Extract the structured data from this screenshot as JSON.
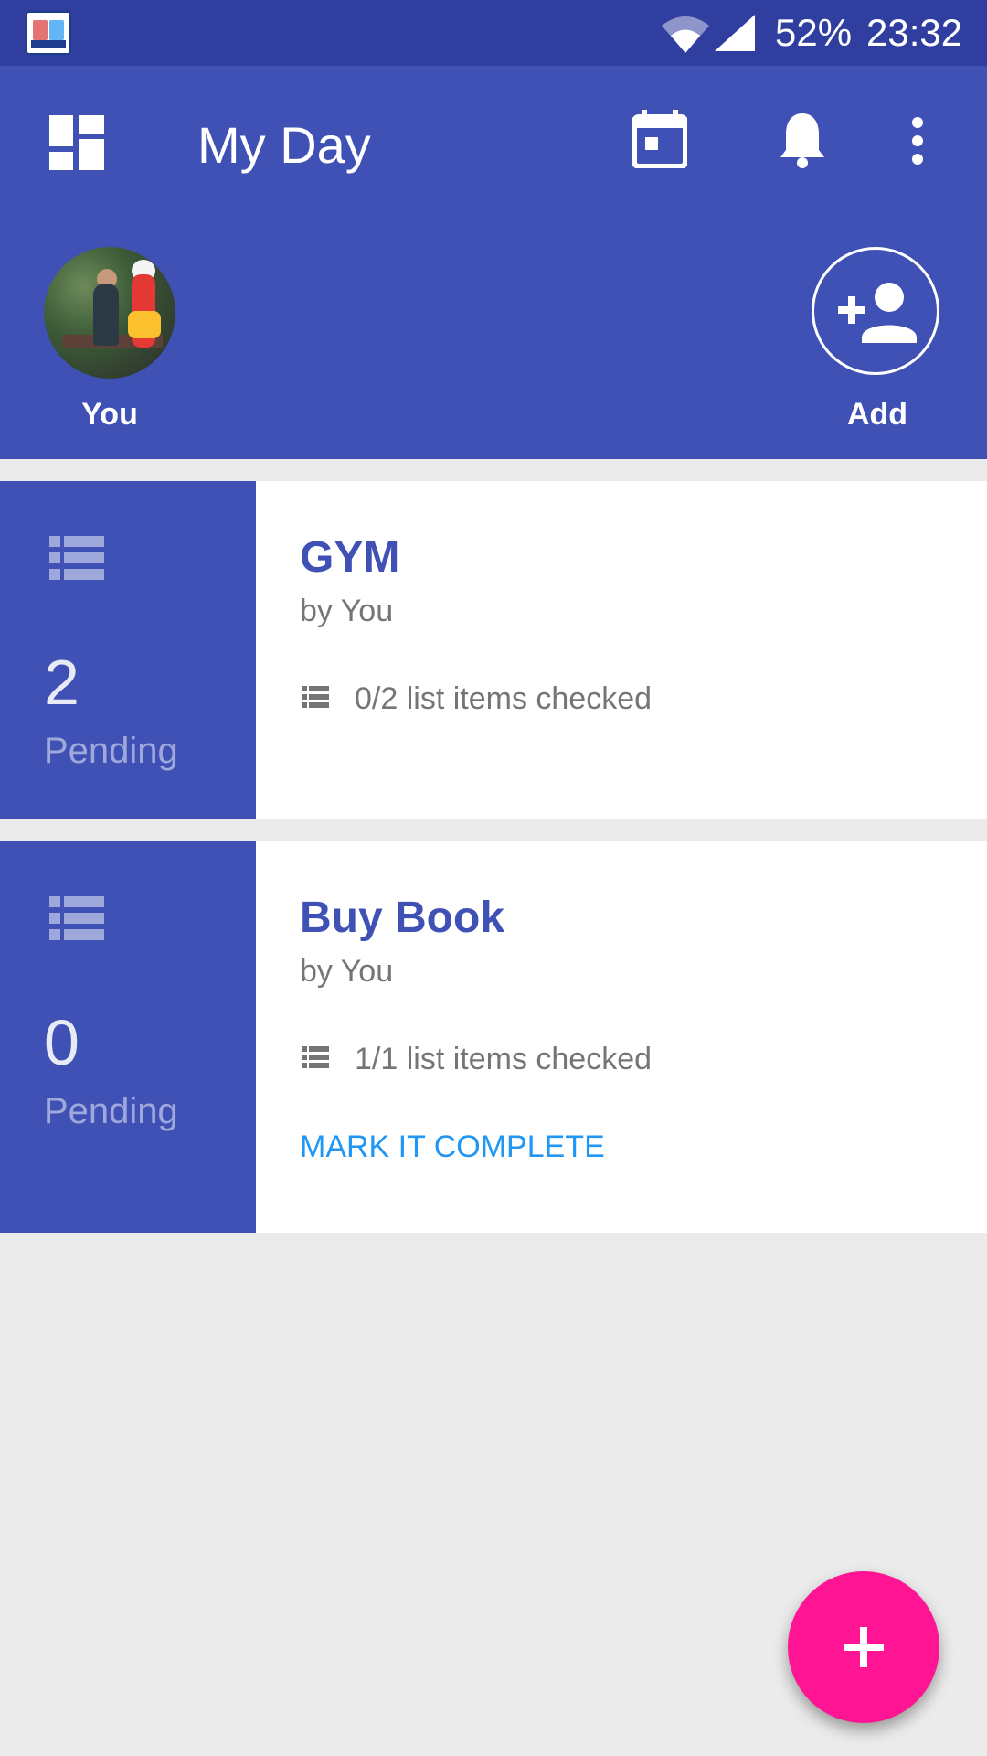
{
  "status_bar": {
    "battery": "52%",
    "time": "23:32",
    "icons": [
      "app-icon",
      "wifi-icon",
      "signal-icon"
    ]
  },
  "app_bar": {
    "title": "My Day",
    "icons": [
      "dashboard-icon",
      "calendar-icon",
      "bell-icon",
      "more-vert-icon"
    ]
  },
  "people": {
    "self_label": "You",
    "add_label": "Add"
  },
  "tasks": [
    {
      "title": "GYM",
      "by": "by You",
      "count": "2",
      "pending_label": "Pending",
      "checked": "0/2 list items checked",
      "action": ""
    },
    {
      "title": "Buy Book",
      "by": "by You",
      "count": "0",
      "pending_label": "Pending",
      "checked": "1/1 list items checked",
      "action": "MARK IT COMPLETE"
    }
  ],
  "fab": {
    "icon": "plus-icon"
  },
  "colors": {
    "primary": "#3f51b5",
    "primary_dark": "#303f9f",
    "accent": "#ff1493",
    "link": "#2196f3",
    "background": "#ebebeb"
  }
}
